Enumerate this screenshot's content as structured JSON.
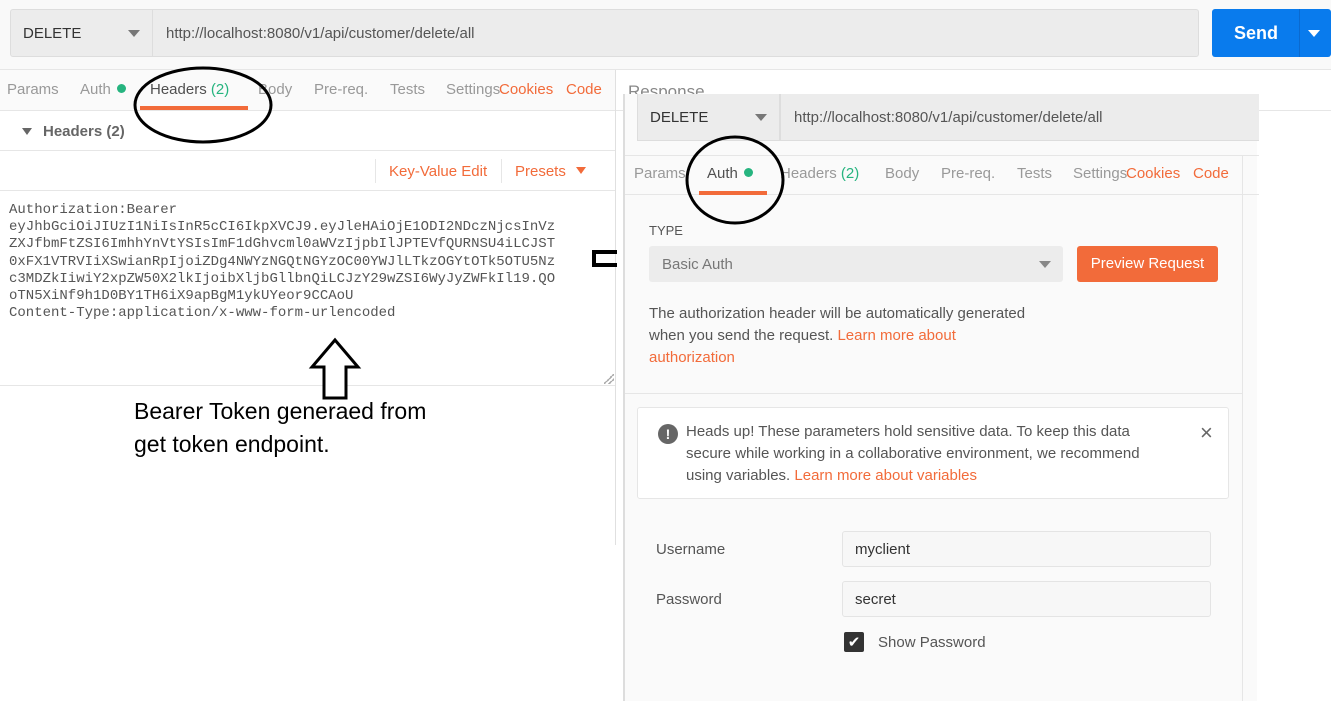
{
  "request": {
    "method": "DELETE",
    "url": "http://localhost:8080/v1/api/customer/delete/all",
    "send_label": "Send"
  },
  "left_tabs": {
    "params": "Params",
    "auth": "Auth",
    "headers": "Headers",
    "headers_count": "(2)",
    "body": "Body",
    "prereq": "Pre-req.",
    "tests": "Tests",
    "settings": "Settings",
    "cookies": "Cookies",
    "code": "Code"
  },
  "headers_section": {
    "title": "Headers (2)",
    "key_value_edit": "Key-Value Edit",
    "presets": "Presets",
    "bulk_text": "Authorization:Bearer\neyJhbGciOiJIUzI1NiIsInR5cCI6IkpXVCJ9.eyJleHAiOjE1ODI2NDczNjcsInVz\nZXJfbmFtZSI6ImhhYnVtYSIsImF1dGhvcml0aWVzIjpbIlJPTEVfQURNSU4iLCJST\n0xFX1VTRVIiXSwianRpIjoiZDg4NWYzNGQtNGYzOC00YWJlLTkzOGYtOTk5OTU5Nz\nc3MDZkIiwiY2xpZW50X2lkIjoibXljbGllbnQiLCJzY29wZSI6WyJyZWFkIl19.QO\noTN5XiNf9h1D0BY1TH6iX9apBgM1ykUYeor9CCAoU\nContent-Type:application/x-www-form-urlencoded"
  },
  "annotation": {
    "line1": "Bearer Token generaed from",
    "line2": "get token endpoint."
  },
  "response_label": "Response",
  "overlay": {
    "method": "DELETE",
    "url": "http://localhost:8080/v1/api/customer/delete/all",
    "tabs": {
      "params": "Params",
      "auth": "Auth",
      "headers": "Headers",
      "headers_count": "(2)",
      "body": "Body",
      "prereq": "Pre-req.",
      "tests": "Tests",
      "settings": "Settings",
      "cookies": "Cookies",
      "code": "Code"
    },
    "type_label": "TYPE",
    "type_value": "Basic Auth",
    "preview_button": "Preview Request",
    "desc1": "The authorization header will be automatically generated",
    "desc2": "when you send the request.",
    "desc_link1": "Learn more about",
    "desc_link2": "authorization",
    "notice1": "Heads up! These parameters hold sensitive data. To keep this data",
    "notice2": "secure while working in a collaborative environment, we recommend",
    "notice3": "using variables.",
    "notice_link": "Learn more about variables",
    "username_label": "Username",
    "username_value": "myclient",
    "password_label": "Password",
    "password_value": "secret",
    "show_password_label": "Show Password",
    "show_password_checked": true
  },
  "colors": {
    "accent": "#f26b3a",
    "send": "#097bed",
    "green": "#26b47f"
  }
}
